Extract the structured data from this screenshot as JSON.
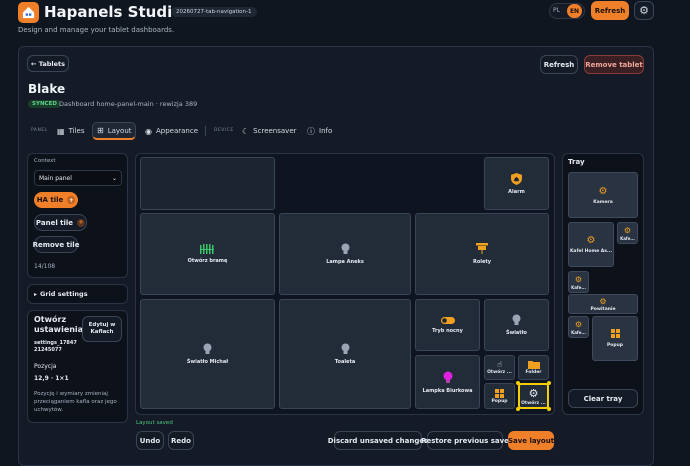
{
  "app": {
    "title": "Hapanels Studio",
    "build": "20260727-tab-navigation-1",
    "subtitle": "Design and manage your tablet dashboards.",
    "lang": [
      "PL",
      "EN"
    ],
    "lang_selected": "EN",
    "refresh": "Refresh",
    "settings_icon": "gear-icon"
  },
  "header": {
    "back": "← Tablets",
    "refresh": "Refresh",
    "remove": "Remove tablet",
    "name": "Blake",
    "status": "SYNCED",
    "meta": "Dashboard home-panel-main · rewizja 389"
  },
  "tabs": {
    "panel_group": "PANEL",
    "device_group": "DEVICE",
    "items": [
      "Tiles",
      "Layout",
      "Appearance",
      "Screensaver",
      "Info"
    ],
    "active": "Layout"
  },
  "sidebar": {
    "context_label": "Context",
    "context_value": "Main panel",
    "ha_tile": "HA tile",
    "panel_tile": "Panel tile",
    "remove_tile": "Remove tile",
    "count": "14/108",
    "grid_settings": "Grid settings",
    "selected": {
      "title": "Otwórz ustawienia",
      "id": "settings_1784721245077",
      "edit": "Edytuj w Kaflach",
      "position_label": "Pozycja",
      "position": "12,9 · 1×1",
      "hint": "Pozycję i wymiary zmieniaj przeciąganiem kafla oraz jego uchwytów."
    }
  },
  "grid": {
    "tiles": [
      "",
      "Alarm",
      "Otwórz bramę",
      "Lampa Aneks",
      "Rolety",
      "Tryb nocny",
      "Światło",
      "Światło Michał",
      "Toaleta",
      "Lampka Biurkowa",
      "Otwórz ...",
      "Folder",
      "Popup",
      "Otwórz ..."
    ]
  },
  "tray": {
    "title": "Tray",
    "tiles": [
      "Kamera",
      "Kafel Home As...",
      "Kafe...",
      "Kafe...",
      "Powitanie",
      "Kafe...",
      "Popup"
    ],
    "clear": "Clear tray"
  },
  "footer": {
    "status": "Layout saved",
    "undo": "Undo",
    "redo": "Redo",
    "discard": "Discard unsaved changes",
    "restore": "Restore previous save",
    "save": "Save layout"
  },
  "colors": {
    "accent": "#f07f2a",
    "synced": "#2f9e5b",
    "selection": "#f5d000",
    "lamp_on": "#e020e0"
  }
}
